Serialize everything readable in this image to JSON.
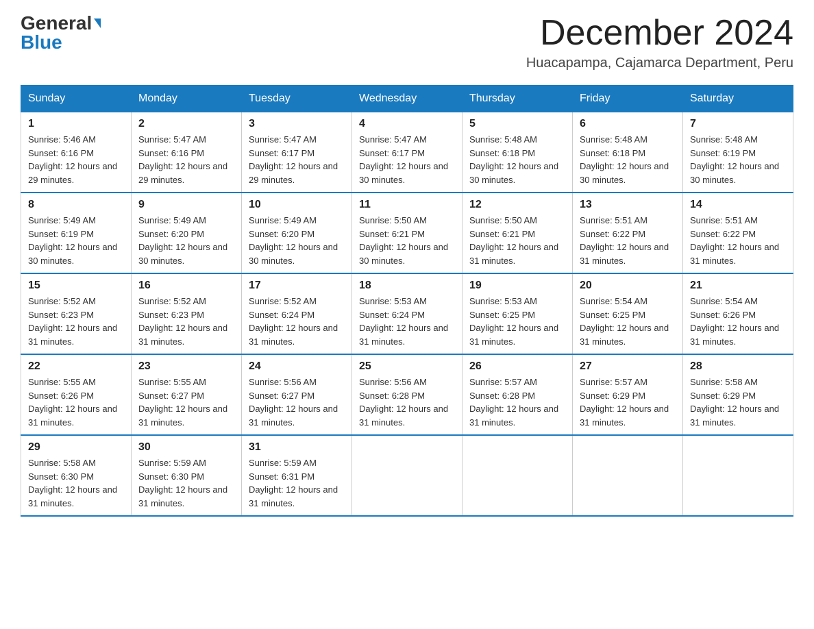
{
  "header": {
    "logo_general": "General",
    "logo_blue": "Blue",
    "month_title": "December 2024",
    "location": "Huacapampa, Cajamarca Department, Peru"
  },
  "days_of_week": [
    "Sunday",
    "Monday",
    "Tuesday",
    "Wednesday",
    "Thursday",
    "Friday",
    "Saturday"
  ],
  "weeks": [
    [
      {
        "day": "1",
        "sunrise": "Sunrise: 5:46 AM",
        "sunset": "Sunset: 6:16 PM",
        "daylight": "Daylight: 12 hours and 29 minutes."
      },
      {
        "day": "2",
        "sunrise": "Sunrise: 5:47 AM",
        "sunset": "Sunset: 6:16 PM",
        "daylight": "Daylight: 12 hours and 29 minutes."
      },
      {
        "day": "3",
        "sunrise": "Sunrise: 5:47 AM",
        "sunset": "Sunset: 6:17 PM",
        "daylight": "Daylight: 12 hours and 29 minutes."
      },
      {
        "day": "4",
        "sunrise": "Sunrise: 5:47 AM",
        "sunset": "Sunset: 6:17 PM",
        "daylight": "Daylight: 12 hours and 30 minutes."
      },
      {
        "day": "5",
        "sunrise": "Sunrise: 5:48 AM",
        "sunset": "Sunset: 6:18 PM",
        "daylight": "Daylight: 12 hours and 30 minutes."
      },
      {
        "day": "6",
        "sunrise": "Sunrise: 5:48 AM",
        "sunset": "Sunset: 6:18 PM",
        "daylight": "Daylight: 12 hours and 30 minutes."
      },
      {
        "day": "7",
        "sunrise": "Sunrise: 5:48 AM",
        "sunset": "Sunset: 6:19 PM",
        "daylight": "Daylight: 12 hours and 30 minutes."
      }
    ],
    [
      {
        "day": "8",
        "sunrise": "Sunrise: 5:49 AM",
        "sunset": "Sunset: 6:19 PM",
        "daylight": "Daylight: 12 hours and 30 minutes."
      },
      {
        "day": "9",
        "sunrise": "Sunrise: 5:49 AM",
        "sunset": "Sunset: 6:20 PM",
        "daylight": "Daylight: 12 hours and 30 minutes."
      },
      {
        "day": "10",
        "sunrise": "Sunrise: 5:49 AM",
        "sunset": "Sunset: 6:20 PM",
        "daylight": "Daylight: 12 hours and 30 minutes."
      },
      {
        "day": "11",
        "sunrise": "Sunrise: 5:50 AM",
        "sunset": "Sunset: 6:21 PM",
        "daylight": "Daylight: 12 hours and 30 minutes."
      },
      {
        "day": "12",
        "sunrise": "Sunrise: 5:50 AM",
        "sunset": "Sunset: 6:21 PM",
        "daylight": "Daylight: 12 hours and 31 minutes."
      },
      {
        "day": "13",
        "sunrise": "Sunrise: 5:51 AM",
        "sunset": "Sunset: 6:22 PM",
        "daylight": "Daylight: 12 hours and 31 minutes."
      },
      {
        "day": "14",
        "sunrise": "Sunrise: 5:51 AM",
        "sunset": "Sunset: 6:22 PM",
        "daylight": "Daylight: 12 hours and 31 minutes."
      }
    ],
    [
      {
        "day": "15",
        "sunrise": "Sunrise: 5:52 AM",
        "sunset": "Sunset: 6:23 PM",
        "daylight": "Daylight: 12 hours and 31 minutes."
      },
      {
        "day": "16",
        "sunrise": "Sunrise: 5:52 AM",
        "sunset": "Sunset: 6:23 PM",
        "daylight": "Daylight: 12 hours and 31 minutes."
      },
      {
        "day": "17",
        "sunrise": "Sunrise: 5:52 AM",
        "sunset": "Sunset: 6:24 PM",
        "daylight": "Daylight: 12 hours and 31 minutes."
      },
      {
        "day": "18",
        "sunrise": "Sunrise: 5:53 AM",
        "sunset": "Sunset: 6:24 PM",
        "daylight": "Daylight: 12 hours and 31 minutes."
      },
      {
        "day": "19",
        "sunrise": "Sunrise: 5:53 AM",
        "sunset": "Sunset: 6:25 PM",
        "daylight": "Daylight: 12 hours and 31 minutes."
      },
      {
        "day": "20",
        "sunrise": "Sunrise: 5:54 AM",
        "sunset": "Sunset: 6:25 PM",
        "daylight": "Daylight: 12 hours and 31 minutes."
      },
      {
        "day": "21",
        "sunrise": "Sunrise: 5:54 AM",
        "sunset": "Sunset: 6:26 PM",
        "daylight": "Daylight: 12 hours and 31 minutes."
      }
    ],
    [
      {
        "day": "22",
        "sunrise": "Sunrise: 5:55 AM",
        "sunset": "Sunset: 6:26 PM",
        "daylight": "Daylight: 12 hours and 31 minutes."
      },
      {
        "day": "23",
        "sunrise": "Sunrise: 5:55 AM",
        "sunset": "Sunset: 6:27 PM",
        "daylight": "Daylight: 12 hours and 31 minutes."
      },
      {
        "day": "24",
        "sunrise": "Sunrise: 5:56 AM",
        "sunset": "Sunset: 6:27 PM",
        "daylight": "Daylight: 12 hours and 31 minutes."
      },
      {
        "day": "25",
        "sunrise": "Sunrise: 5:56 AM",
        "sunset": "Sunset: 6:28 PM",
        "daylight": "Daylight: 12 hours and 31 minutes."
      },
      {
        "day": "26",
        "sunrise": "Sunrise: 5:57 AM",
        "sunset": "Sunset: 6:28 PM",
        "daylight": "Daylight: 12 hours and 31 minutes."
      },
      {
        "day": "27",
        "sunrise": "Sunrise: 5:57 AM",
        "sunset": "Sunset: 6:29 PM",
        "daylight": "Daylight: 12 hours and 31 minutes."
      },
      {
        "day": "28",
        "sunrise": "Sunrise: 5:58 AM",
        "sunset": "Sunset: 6:29 PM",
        "daylight": "Daylight: 12 hours and 31 minutes."
      }
    ],
    [
      {
        "day": "29",
        "sunrise": "Sunrise: 5:58 AM",
        "sunset": "Sunset: 6:30 PM",
        "daylight": "Daylight: 12 hours and 31 minutes."
      },
      {
        "day": "30",
        "sunrise": "Sunrise: 5:59 AM",
        "sunset": "Sunset: 6:30 PM",
        "daylight": "Daylight: 12 hours and 31 minutes."
      },
      {
        "day": "31",
        "sunrise": "Sunrise: 5:59 AM",
        "sunset": "Sunset: 6:31 PM",
        "daylight": "Daylight: 12 hours and 31 minutes."
      },
      null,
      null,
      null,
      null
    ]
  ]
}
